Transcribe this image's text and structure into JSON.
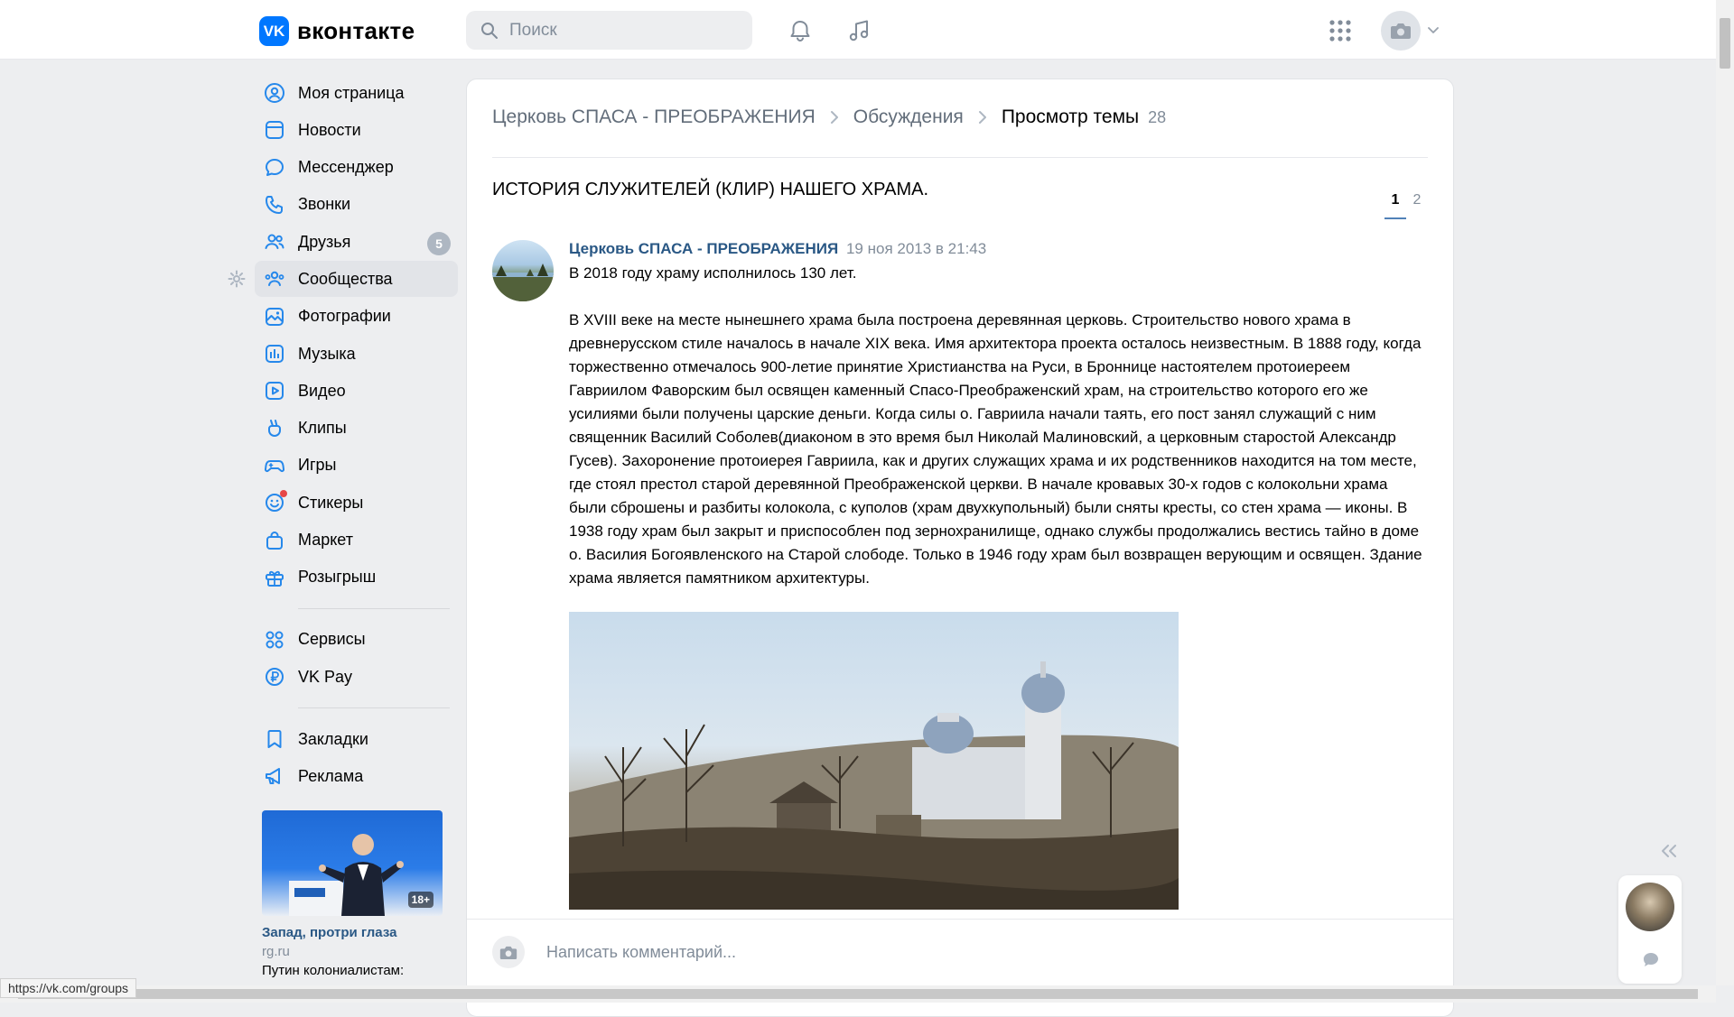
{
  "header": {
    "logo_mark": "VK",
    "logo_text": "вконтакте",
    "search_placeholder": "Поиск"
  },
  "sidebar": {
    "items": [
      {
        "label": "Моя страница",
        "icon": "user-circle-icon"
      },
      {
        "label": "Новости",
        "icon": "newsfeed-icon"
      },
      {
        "label": "Мессенджер",
        "icon": "message-icon"
      },
      {
        "label": "Звонки",
        "icon": "phone-icon"
      },
      {
        "label": "Друзья",
        "icon": "users-icon",
        "badge": "5"
      },
      {
        "label": "Сообщества",
        "icon": "groups-icon",
        "active": true
      },
      {
        "label": "Фотографии",
        "icon": "picture-icon"
      },
      {
        "label": "Музыка",
        "icon": "music-icon"
      },
      {
        "label": "Видео",
        "icon": "video-icon"
      },
      {
        "label": "Клипы",
        "icon": "clips-icon"
      },
      {
        "label": "Игры",
        "icon": "gamepad-icon"
      },
      {
        "label": "Стикеры",
        "icon": "smile-icon"
      },
      {
        "label": "Маркет",
        "icon": "market-bag-icon"
      },
      {
        "label": "Розыгрыш",
        "icon": "gift-icon"
      }
    ],
    "items2": [
      {
        "label": "Сервисы",
        "icon": "services-icon"
      },
      {
        "label": "VK Pay",
        "icon": "vkpay-icon"
      }
    ],
    "items3": [
      {
        "label": "Закладки",
        "icon": "bookmark-icon"
      },
      {
        "label": "Реклама",
        "icon": "megaphone-icon"
      }
    ],
    "promo": {
      "age": "18+",
      "title": "Запад, протри глаза",
      "source": "rg.ru",
      "desc": "Путин колониалистам:"
    }
  },
  "breadcrumb": {
    "group": "Церковь СПАСА - ПРЕОБРАЖЕНИЯ",
    "section": "Обсуждения",
    "current": "Просмотр темы",
    "count": "28"
  },
  "topic": {
    "title": "ИСТОРИЯ СЛУЖИТЕЛЕЙ (КЛИР) НАШЕГО ХРАМА.",
    "pages": [
      "1",
      "2"
    ]
  },
  "post": {
    "author": "Церковь СПАСА - ПРЕОБРАЖЕНИЯ",
    "date": "19 ноя 2013 в 21:43",
    "text": "В 2018 году храму исполнилось 130 лет.\n\nВ XVIII веке на месте нынешнего храма была построена деревянная церковь. Строительство нового храма в древнерусском стиле началось в начале XIX века. Имя архитектора проекта осталось неизвестным. В 1888 году, когда торжественно отмечалось 900-летие принятие Христианства на Руси, в Броннице настоятелем протоиереем Гавриилом Фаворским был освящен каменный Спасо-Преображенский храм, на строительство которого его же усилиями были получены царские деньги. Когда силы о. Гавриила начали таять, его пост занял служащий с ним священник Василий Соболев(диаконом в это время был Николай Малиновский, а церковным старостой Александр Гусев). Захоронение протоиерея Гавриила, как и других служащих храма и их родственников находится на том месте, где стоял престол старой деревянной Преображенской церкви. В начале кровавых 30-х годов с колокольни храма были сброшены и разбиты колокола, с куполов (храм двухкупольный) были сняты кресты, со стен храма — иконы. В 1938 году храм был закрыт и приспособлен под зернохранилище, однако службы продолжались вестись тайно в доме о. Василия Богоявленского на Старой слободе. Только в 1946 году храм был возвращен верующим и освящен. Здание храма является памятником архитектуры."
  },
  "composer": {
    "placeholder": "Написать комментарий..."
  },
  "status_bar": {
    "url": "https://vk.com/groups"
  },
  "colors": {
    "accent": "#0077ff",
    "link": "#2a5885",
    "background": "#edeef0",
    "muted": "#818c99"
  }
}
